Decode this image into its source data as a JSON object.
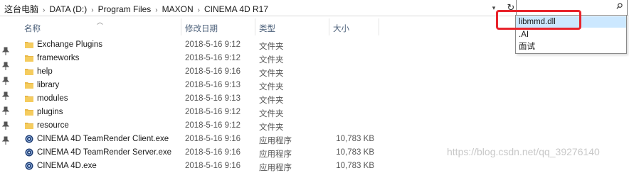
{
  "breadcrumb": [
    "这台电脑",
    "DATA (D:)",
    "Program Files",
    "MAXON",
    "CINEMA 4D R17"
  ],
  "search": {
    "value": ""
  },
  "columns": {
    "name": "名称",
    "date": "修改日期",
    "type": "类型",
    "size": "大小"
  },
  "rows": [
    {
      "name": "Exchange Plugins",
      "date": "2018-5-16 9:12",
      "type": "文件夹",
      "size": "",
      "icon": "folder-icon"
    },
    {
      "name": "frameworks",
      "date": "2018-5-16 9:12",
      "type": "文件夹",
      "size": "",
      "icon": "folder-icon"
    },
    {
      "name": "help",
      "date": "2018-5-16 9:16",
      "type": "文件夹",
      "size": "",
      "icon": "folder-icon"
    },
    {
      "name": "library",
      "date": "2018-5-16 9:13",
      "type": "文件夹",
      "size": "",
      "icon": "folder-icon"
    },
    {
      "name": "modules",
      "date": "2018-5-16 9:13",
      "type": "文件夹",
      "size": "",
      "icon": "folder-icon"
    },
    {
      "name": "plugins",
      "date": "2018-5-16 9:12",
      "type": "文件夹",
      "size": "",
      "icon": "folder-icon"
    },
    {
      "name": "resource",
      "date": "2018-5-16 9:12",
      "type": "文件夹",
      "size": "",
      "icon": "folder-icon"
    },
    {
      "name": "CINEMA 4D TeamRender Client.exe",
      "date": "2018-5-16 9:16",
      "type": "应用程序",
      "size": "10,783 KB",
      "icon": "cinema4d-app-icon"
    },
    {
      "name": "CINEMA 4D TeamRender Server.exe",
      "date": "2018-5-16 9:16",
      "type": "应用程序",
      "size": "10,783 KB",
      "icon": "cinema4d-app-icon"
    },
    {
      "name": "CINEMA 4D.exe",
      "date": "2018-5-16 9:16",
      "type": "应用程序",
      "size": "10,783 KB",
      "icon": "cinema4d-app-icon"
    }
  ],
  "suggestions": [
    "libmmd.dll",
    ".AI",
    "面试"
  ],
  "watermark": "https://blog.csdn.net/qq_39276140",
  "colors": {
    "folder": "#e8b84a",
    "selection": "#cce8ff",
    "annotation": "#e8242c",
    "header_text": "#4c607a"
  }
}
